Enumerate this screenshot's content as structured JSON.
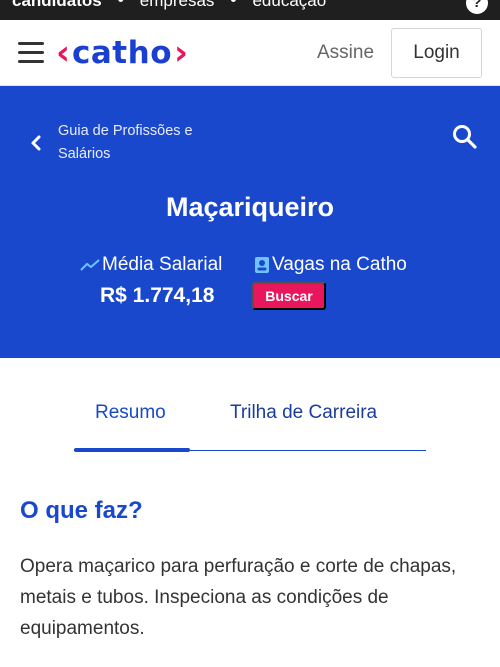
{
  "topbar": {
    "links": [
      "candidatos",
      "empresas",
      "educação"
    ],
    "separator": "•",
    "help_label": "?"
  },
  "header": {
    "logo_text": "catho",
    "logo_left": "‹",
    "logo_right": "›",
    "assine_label": "Assine",
    "login_label": "Login"
  },
  "hero": {
    "breadcrumb": "Guia de Profissões e Salários",
    "title": "Maçariqueiro",
    "salary_label": "Média Salarial",
    "salary_value": "R$ 1.774,18",
    "jobs_label": "Vagas na Catho",
    "search_button": "Buscar"
  },
  "tabs": [
    {
      "label": "Resumo",
      "active": true
    },
    {
      "label": "Trilha de Carreira",
      "active": false
    }
  ],
  "content": {
    "section_title": "O que faz?",
    "description": "Opera maçarico para perfuração e corte de chapas, metais e tubos. Inspeciona as condições de equipamentos."
  },
  "colors": {
    "brand_blue": "#1a48cc",
    "brand_pink": "#e8175d",
    "trend_blue": "#6fc3ff"
  },
  "icons": [
    "menu-icon",
    "back-icon",
    "search-icon",
    "trend-icon",
    "badge-icon",
    "help-icon"
  ]
}
